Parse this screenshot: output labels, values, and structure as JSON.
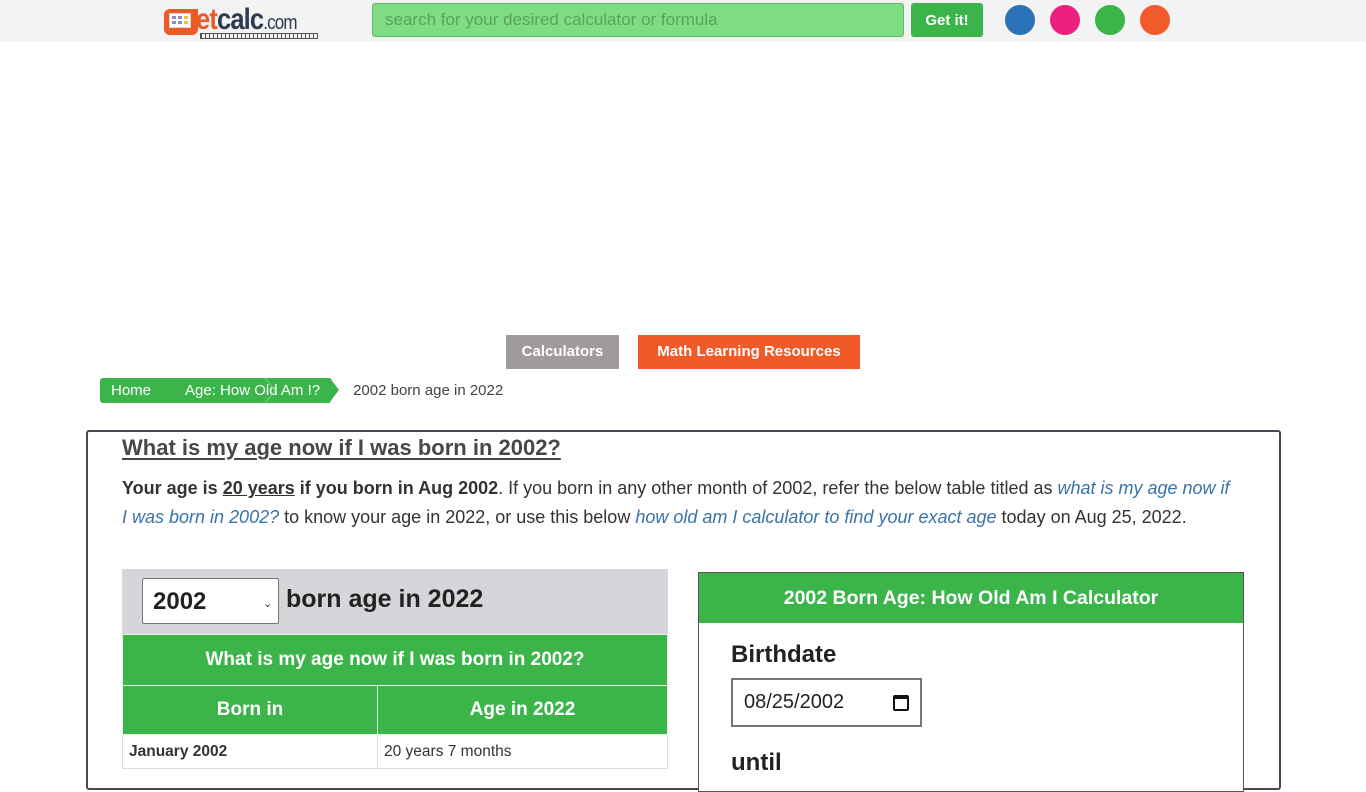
{
  "header": {
    "logo": {
      "prefix": "g",
      "et": "et",
      "calc": "calc",
      "com": ".com"
    },
    "search": {
      "placeholder": "search for your desired calculator or formula",
      "value": ""
    },
    "search_button": "Get it!",
    "social_icons": [
      {
        "name": "facebook-icon",
        "color": "#2a72b8"
      },
      {
        "name": "pinterest-icon",
        "color": "#ea1f7e"
      },
      {
        "name": "share-icon",
        "color": "#3bb44a"
      },
      {
        "name": "reddit-icon",
        "color": "#f15a2a"
      }
    ]
  },
  "nav": {
    "calculators": "Calculators",
    "math_resources": "Math Learning Resources"
  },
  "breadcrumb": {
    "home": "Home",
    "age": "Age: How Old Am I?",
    "current": "2002 born age in 2022"
  },
  "main": {
    "title": "What is my age now if I was born in 2002?",
    "intro": {
      "bold_start": "Your age is ",
      "bold_age": "20 years",
      "bold_end": " if you born in Aug 2002",
      "text1": ". If you born in any other month of 2002, refer the below table titled as ",
      "link1": "what is my age now if I was born in 2002?",
      "text2": " to know your age in 2022, or use this below ",
      "link2": "how old am I calculator to find your exact age",
      "text3": " today on Aug 25, 2022."
    }
  },
  "year_selector": {
    "selected": "2002",
    "label": "born age in 2022"
  },
  "age_table": {
    "caption": "What is my age now if I was born in 2002?",
    "headers": [
      "Born in",
      "Age in 2022"
    ],
    "rows": [
      {
        "month": "January 2002",
        "age": "20 years 7 months"
      }
    ]
  },
  "calculator": {
    "title": "2002 Born Age: How Old Am I Calculator",
    "birthdate_label": "Birthdate",
    "birthdate_value": "08/25/2002",
    "until_label": "until"
  },
  "colors": {
    "green": "#3bb44a",
    "orange": "#f05a28",
    "gray_button": "#a09b9a",
    "link": "#3a73a8"
  }
}
